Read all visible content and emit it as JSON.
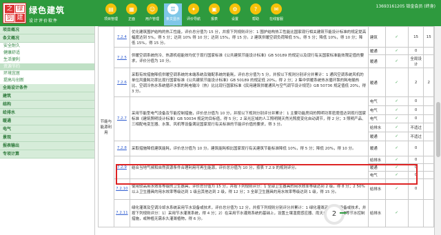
{
  "header": {
    "logo_chars": [
      "之",
      "绿",
      "剑",
      "建"
    ],
    "brand_title": "绿色建筑",
    "brand_sub": "设计评价软件",
    "user_info": "13693161205 铂金会员 (终身)",
    "nav": [
      {
        "label": "项目管理",
        "icon": "folder-icon"
      },
      {
        "label": "正面",
        "icon": "document-icon"
      },
      {
        "label": "用户管理",
        "icon": "user-icon"
      },
      {
        "label": "条文显示",
        "icon": "list-icon"
      },
      {
        "label": "评价导航",
        "icon": "compass-icon"
      },
      {
        "label": "报表",
        "icon": "report-icon"
      },
      {
        "label": "设置",
        "icon": "gear-icon"
      },
      {
        "label": "帮助",
        "icon": "help-icon"
      },
      {
        "label": "在线客服",
        "icon": "chat-icon"
      }
    ]
  },
  "sidebar": {
    "sections": [
      {
        "title": "项目概况",
        "items": []
      },
      {
        "title": "条文概况",
        "items": [
          "安全耐久",
          "健康舒适",
          "生活便利",
          "资源节约",
          "环境宜居",
          "提高与创新"
        ]
      },
      {
        "title": "全局设计条件",
        "items": []
      },
      {
        "title": "建筑",
        "items": []
      },
      {
        "title": "结构",
        "items": []
      },
      {
        "title": "给排水",
        "items": []
      },
      {
        "title": "暖通",
        "items": []
      },
      {
        "title": "电气",
        "items": []
      },
      {
        "title": "景观",
        "items": []
      },
      {
        "title": "报表输出",
        "items": []
      },
      {
        "title": "专项计算",
        "items": []
      }
    ],
    "selected_item": "资源节约"
  },
  "table": {
    "category_label": "节能与能源利用",
    "rows": [
      {
        "code": "7.2.4",
        "desc": "优化建筑围护结构的热工性能，评价总分值为 15 分，并按下列规则评分：1 围护结构热工性能比国家现行相关建筑节能设计标准的规定提高幅度达到 5%，得 5 分；达到 10% 得 10 分；达到 15%，得 15 分。2 建筑供暖空调负荷降低 5%，得 5 分；降低 10%，得 10 分；降低 15%，得 15 分。",
        "sub": [
          {
            "cat": "建筑",
            "check": "✓",
            "score": "15",
            "total": "15"
          }
        ]
      },
      {
        "code": "7.2.5",
        "desc": "供暖空调系统的冷、热源机组能效均优于现行国家标准《公共建筑节能设计标准》GB 50189 的规定以及现行有关国家标准能效限定值的要求，评价分值为 10 分。",
        "sub": [
          {
            "cat": "暖通",
            "check": "✓",
            "score": "0",
            "total": ""
          },
          {
            "cat": "暖通",
            "check": "✓",
            "score": "全局设计",
            "total": ""
          }
        ]
      },
      {
        "code": "7.2.6",
        "desc": "采取有效措施降低供暖空调系统的末端系统及输配系统的能耗，评价总分值为 5 分，并按以下规则分别评分并累计：1 通风空调系统风机的单位风量耗功率比现行国家标准《公共建筑节能设计标准》GB 50189 的规定低 20%，得 2 分；2 集中供暖系统热水循环泵的耗电输热比、空调冷热水系统循环水泵的耗电输冷（热）比比现行国家标准《民用建筑供暖通风与空气调节设计规范》GB 50736 规定值低 20%，得 3 分。",
        "sub": [
          {
            "cat": "暖通",
            "check": "✓",
            "score": "2",
            "total": "2"
          }
        ]
      },
      {
        "code": "7.2.7",
        "desc": "采用节能型电气设备及节能控制措施，评价总分值为 10 分，并按以下规则分别评分并累计：1 主要功能房间的照明功率密度值达到现行国家标准《建筑照明设计标准》GB 50034 规定的目标值，得 5 分；2 采光区域的人工照明随天然光照度变化自动调节，得 2 分；3 照明产品、三相配电变压器、水泵、风机等设备满足国家现行有关标准的节能评价值的要求，得 3 分。",
        "sub": [
          {
            "cat": "电气",
            "check": "✓",
            "score": "0",
            "total": ""
          },
          {
            "cat": "电气",
            "check": "✓",
            "score": "0",
            "total": ""
          },
          {
            "cat": "电气",
            "check": "✓",
            "score": "0",
            "total": ""
          },
          {
            "cat": "给排水",
            "check": "✓",
            "score": "不适过",
            "total": ""
          },
          {
            "cat": "暖通",
            "check": "✓",
            "score": "不适过",
            "total": ""
          }
        ]
      },
      {
        "code": "7.2.8",
        "desc": "采取措施降低建筑能耗，评价总分值为 10 分。建筑能耗相比国家现行有关建筑节能标准降低 10%，得 5 分；降低 20%，得 10 分。",
        "sub": [
          {
            "cat": "暖通",
            "check": "✓",
            "score": "0",
            "total": ""
          }
        ]
      },
      {
        "code": "7.2.9",
        "desc": "结合当地气候和自然资源条件合理利用可再生能源，评价总分值为 10 分，按表 7.2.9 的规则评分。",
        "sub": [
          {
            "cat": "给排水",
            "check": "✓",
            "score": "0",
            "total": ""
          },
          {
            "cat": "暖通",
            "check": "✓",
            "score": "0",
            "total": ""
          },
          {
            "cat": "电气",
            "check": "✓",
            "score": "0",
            "total": ""
          }
        ]
      },
      {
        "code": "7.2.10",
        "desc": "使用较高用水效率等级的卫生器具，评价总分值为 15 分，并按下列规则评分：1 全部卫生器具的用水效率等级达到 2 级，得 8 分；2 50% 以上卫生器具的用水效率等级达到 1 级且其他达到 2 级，得 12 分；3 全部卫生器具的用水效率等级达到 1 级，得 15 分。",
        "sub": [
          {
            "cat": "给排水",
            "check": "✓",
            "score": "0",
            "total": ""
          }
        ]
      },
      {
        "code": "7.2.11",
        "desc": "绿化灌溉及空调冷却水系统采用节水设备或技术，评价总分值为 12 分，并按下列规则分别评分并累计：1 绿化灌溉采用节水设备或技术，并按下列规则评分：1）采用节水灌溉系统，得 4 分；2）在采用节水灌溉系统的基础上，设置土壤湿度感应器、雨天自动关闭装置等节水控制措施，或种植无需永久灌溉植物，得 6 分。",
        "sub": [
          {
            "cat": "给排水",
            "check": "✓",
            "score": "",
            "total": ""
          }
        ]
      }
    ]
  },
  "float_badge": "2",
  "colors": {
    "header": "#2e9a3e",
    "accent": "#f6c20a",
    "highlight": "#dd2222"
  }
}
